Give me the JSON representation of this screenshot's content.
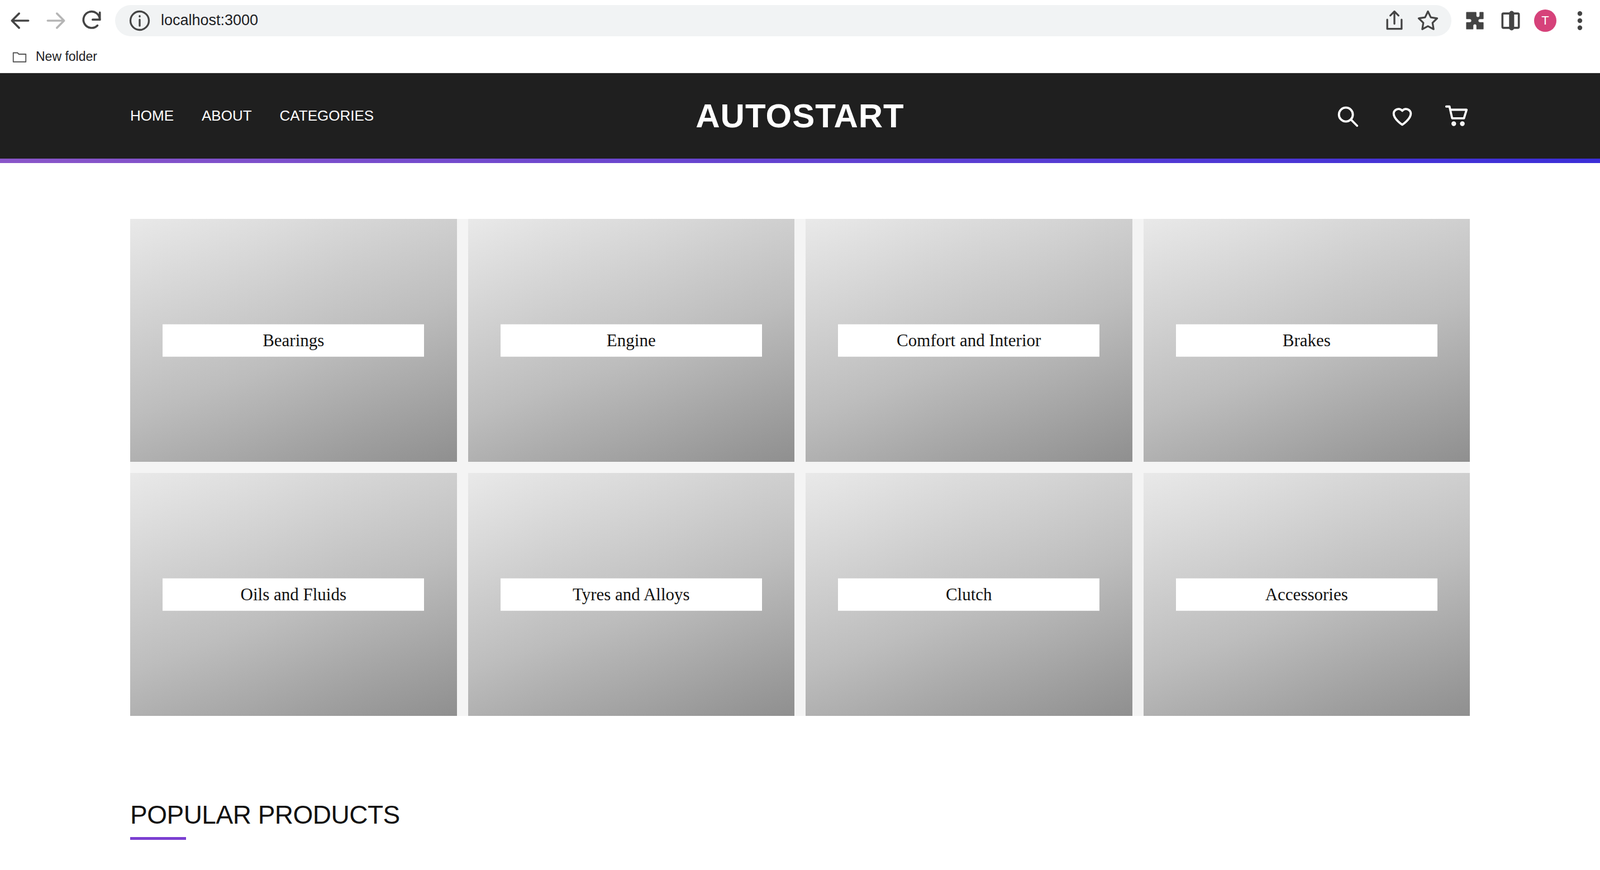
{
  "browser": {
    "back": {
      "disabled": false
    },
    "forward": {
      "disabled": true
    },
    "address": "localhost:3000",
    "profile": "T",
    "bookmarks": [
      "New folder"
    ]
  },
  "nav": {
    "links": [
      "HOME",
      "ABOUT",
      "CATEGORIES"
    ],
    "logo": "AUTOSTART"
  },
  "categories": [
    {
      "label": "Bearings"
    },
    {
      "label": "Engine"
    },
    {
      "label": "Comfort and Interior"
    },
    {
      "label": "Brakes"
    },
    {
      "label": "Oils and Fluids"
    },
    {
      "label": "Tyres and Alloys"
    },
    {
      "label": "Clutch"
    },
    {
      "label": "Accessories"
    }
  ],
  "popular": {
    "title": "POPULAR PRODUCTS"
  }
}
